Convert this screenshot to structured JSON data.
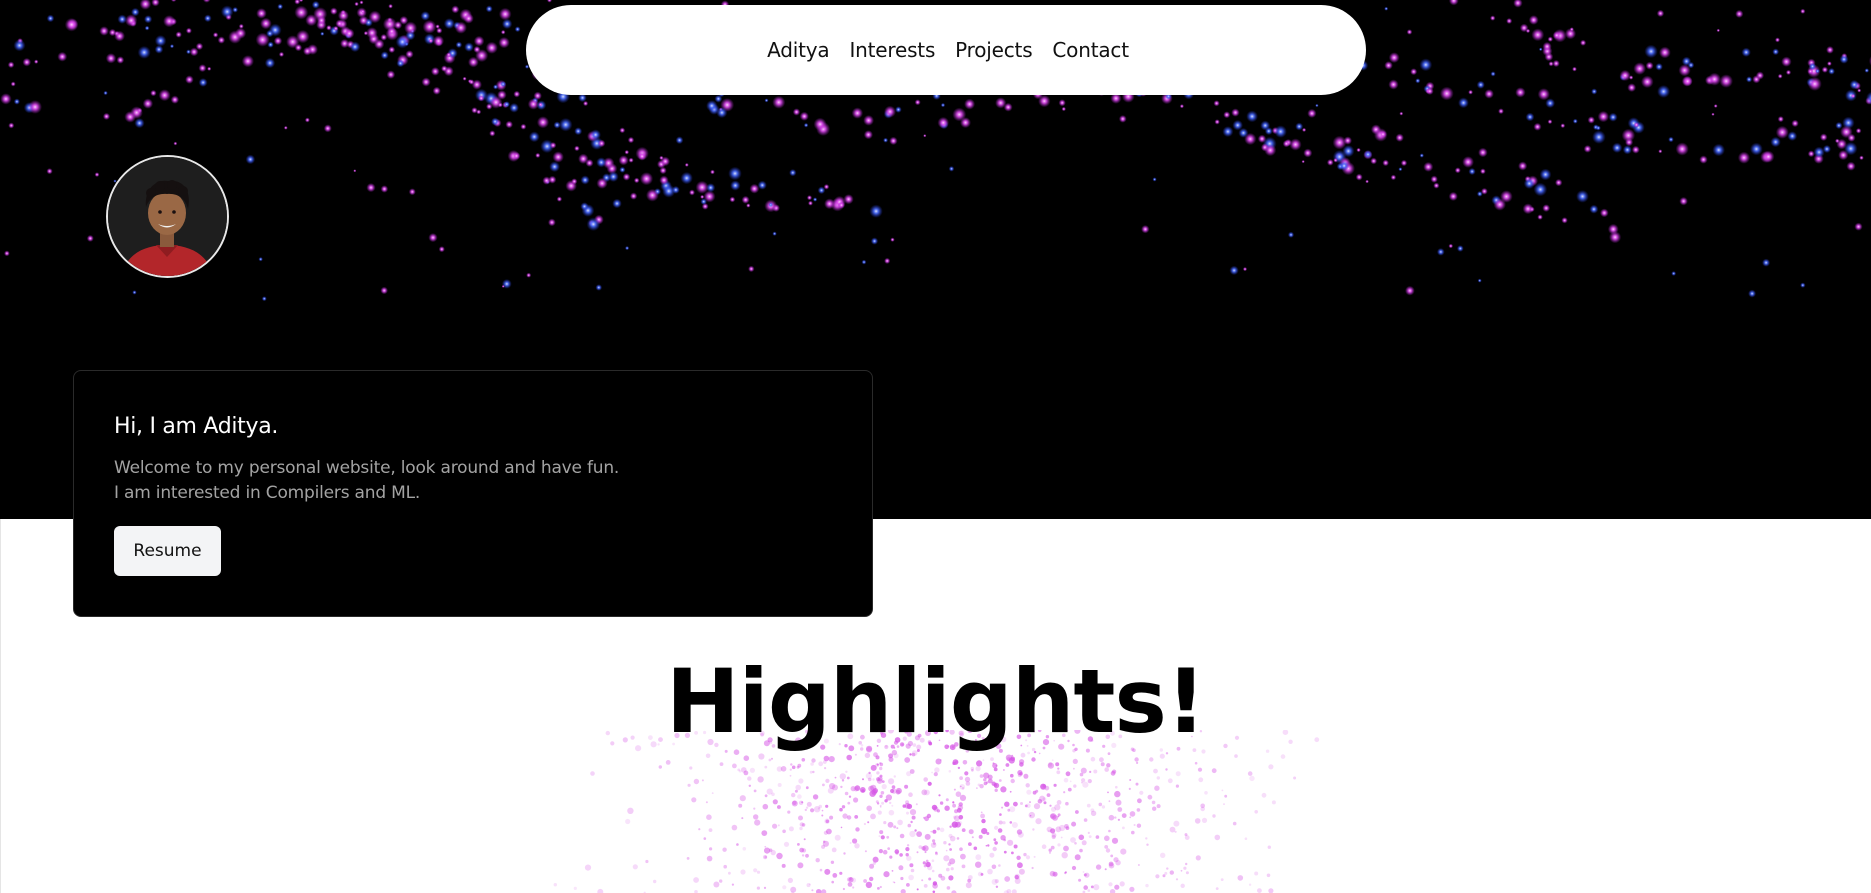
{
  "nav": {
    "links": [
      "Aditya",
      "Interests",
      "Projects",
      "Contact"
    ]
  },
  "intro": {
    "title": "Hi, I am Aditya.",
    "line1": "Welcome to my personal website, look around and have fun.",
    "line2": "I am interested in Compilers and ML.",
    "resume_label": "Resume"
  },
  "highlights": {
    "title": "Highlights!"
  },
  "colors": {
    "hero_background": "#000000",
    "particle_pink": "#e04cf0",
    "particle_blue": "#4a6cff",
    "card_background": "#000000",
    "button_background": "#f3f4f6",
    "dots_pink": "#d656e6"
  },
  "icons": {
    "avatar": "profile-photo"
  }
}
